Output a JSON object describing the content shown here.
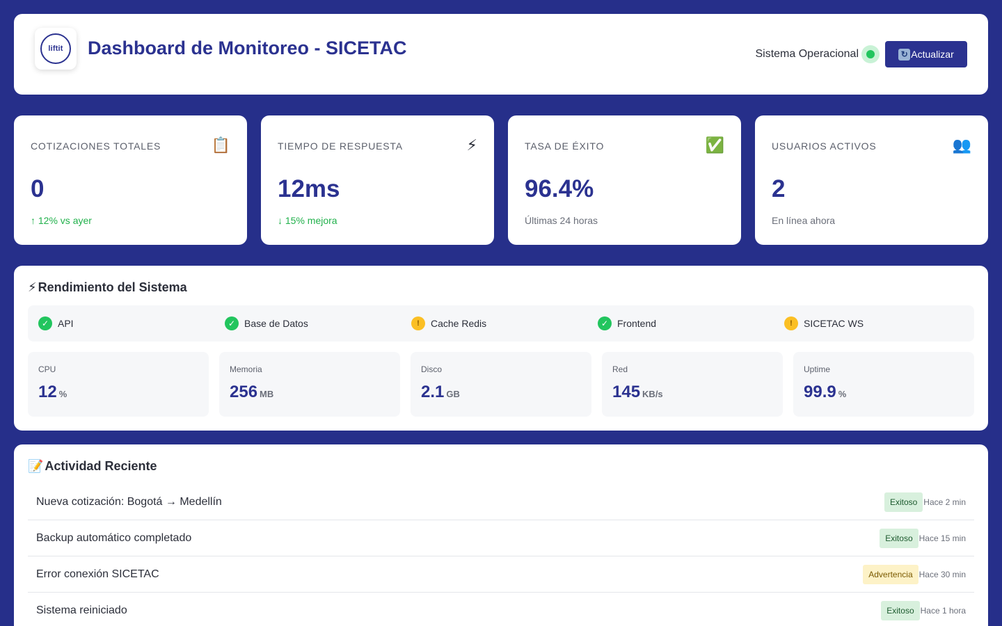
{
  "header": {
    "logo_text": "liftit",
    "title": "Dashboard de Monitoreo - SICETAC",
    "status_text": "Sistema Operacional",
    "refresh_label": "Actualizar",
    "refresh_icon": "refresh-icon"
  },
  "stats": [
    {
      "label": "COTIZACIONES TOTALES",
      "icon": "📋",
      "value": "0",
      "sub": "↑ 12% vs ayer",
      "sub_status": "positive"
    },
    {
      "label": "TIEMPO DE RESPUESTA",
      "icon": "⚡",
      "value": "12ms",
      "sub": "↓ 15% mejora",
      "sub_status": "positive"
    },
    {
      "label": "TASA DE ÉXITO",
      "icon": "✅",
      "value": "96.4%",
      "sub": "Últimas 24 horas",
      "sub_status": "neutral"
    },
    {
      "label": "USUARIOS ACTIVOS",
      "icon": "👥",
      "value": "2",
      "sub": "En línea ahora",
      "sub_status": "neutral"
    }
  ],
  "performance": {
    "title_icon": "⚡",
    "title": "Rendimiento del Sistema",
    "services": [
      {
        "name": "API",
        "status": "ok",
        "icon": "✓"
      },
      {
        "name": "Base de Datos",
        "status": "ok",
        "icon": "✓"
      },
      {
        "name": "Cache Redis",
        "status": "warning",
        "icon": "!"
      },
      {
        "name": "Frontend",
        "status": "ok",
        "icon": "✓"
      },
      {
        "name": "SICETAC WS",
        "status": "warning",
        "icon": "!"
      }
    ],
    "metrics": [
      {
        "label": "CPU",
        "value": "12",
        "unit": "%"
      },
      {
        "label": "Memoria",
        "value": "256",
        "unit": "MB"
      },
      {
        "label": "Disco",
        "value": "2.1",
        "unit": "GB"
      },
      {
        "label": "Red",
        "value": "145",
        "unit": "KB/s"
      },
      {
        "label": "Uptime",
        "value": "99.9",
        "unit": "%"
      }
    ]
  },
  "activity": {
    "title_icon": "📝",
    "title": "Actividad Reciente",
    "items": [
      {
        "text": "Nueva cotización: Bogotá → Medellín",
        "badge": "Exitoso",
        "badge_type": "success",
        "time": "Hace 2 min"
      },
      {
        "text": "Backup automático completado",
        "badge": "Exitoso",
        "badge_type": "success",
        "time": "Hace 15 min"
      },
      {
        "text": "Error conexión SICETAC",
        "badge": "Advertencia",
        "badge_type": "warning",
        "time": "Hace 30 min"
      },
      {
        "text": "Sistema reiniciado",
        "badge": "Exitoso",
        "badge_type": "success",
        "time": "Hace 1 hora"
      }
    ]
  },
  "colors": {
    "background": "#262f8a",
    "primary": "#2b3290",
    "success": "#22c55e",
    "warning": "#fbbf24"
  }
}
